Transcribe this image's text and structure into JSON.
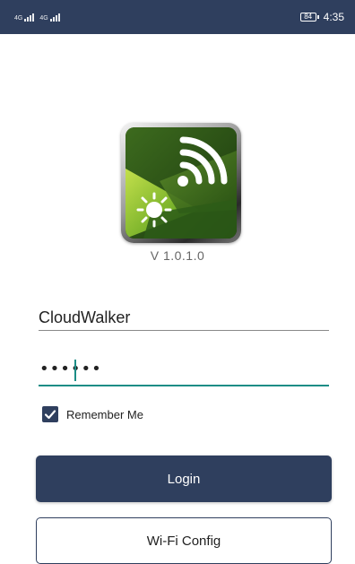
{
  "status_bar": {
    "signal_1": "4G",
    "signal_2": "4G",
    "battery": "84",
    "time": "4:35"
  },
  "app": {
    "logo_icon": "solar-wifi-logo",
    "version": "V 1.0.1.0"
  },
  "login_form": {
    "username_value": "CloudWalker",
    "password_mask": "••••••",
    "remember_me_label": "Remember Me",
    "remember_me_checked": true,
    "login_label": "Login",
    "wifi_config_label": "Wi-Fi Config"
  },
  "colors": {
    "primary": "#2f3f5e",
    "accent": "#1c8d86"
  }
}
